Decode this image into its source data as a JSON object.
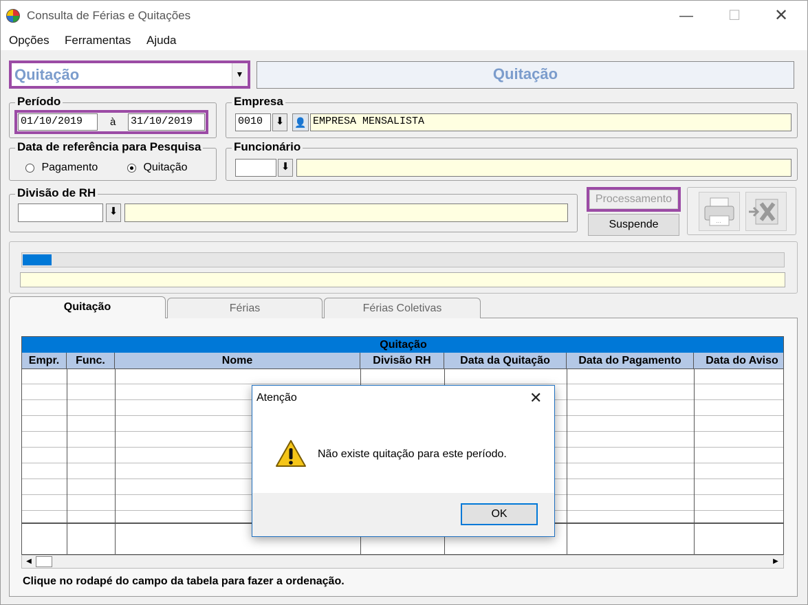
{
  "window": {
    "title": "Consulta de Férias e Quitações"
  },
  "menu": [
    "Opções",
    "Ferramentas",
    "Ajuda"
  ],
  "top": {
    "mode_select": "Quitação",
    "mode_title": "Quitação"
  },
  "periodo": {
    "label": "Período",
    "from": "01/10/2019",
    "separator": "à",
    "to": "31/10/2019"
  },
  "empresa": {
    "label": "Empresa",
    "code": "0010",
    "name": "EMPRESA MENSALISTA"
  },
  "data_ref": {
    "label": "Data de referência para Pesquisa",
    "opt1": "Pagamento",
    "opt2": "Quitação",
    "selected": "Quitação"
  },
  "funcionario": {
    "label": "Funcionário",
    "code": "",
    "name": ""
  },
  "divisao": {
    "label": "Divisão de RH",
    "code": "",
    "name": ""
  },
  "buttons": {
    "processamento": "Processamento",
    "suspende": "Suspende"
  },
  "tabs": [
    "Quitação",
    "Férias",
    "Férias Coletivas"
  ],
  "grid": {
    "banner": "Quitação",
    "columns": [
      "Empr.",
      "Func.",
      "Nome",
      "Divisão RH",
      "Data da Quitação",
      "Data do Pagamento",
      "Data do Aviso"
    ]
  },
  "footer_hint": "Clique no rodapé do campo da tabela  para fazer a ordenação.",
  "dialog": {
    "title": "Atenção",
    "message": "Não existe quitação para este período.",
    "ok": "OK"
  },
  "colors": {
    "accent_purple": "#9b4ba5",
    "grid_banner": "#0078d7",
    "header_blue": "#b4c8e6",
    "field_yellow": "#ffffe1",
    "mode_text": "#7b9ccc"
  }
}
